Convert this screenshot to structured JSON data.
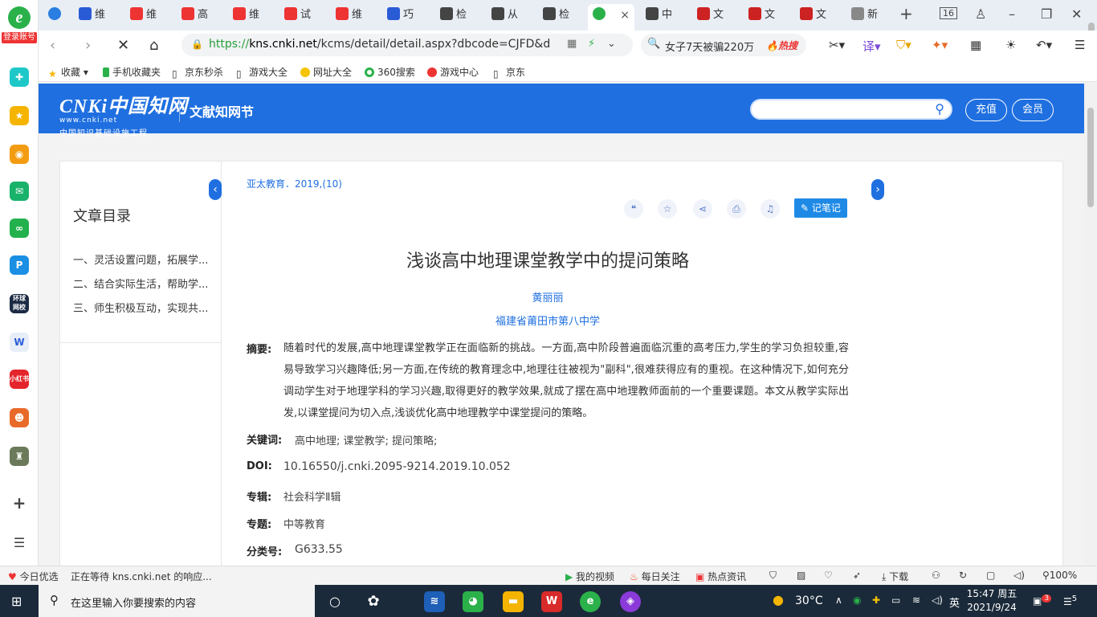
{
  "browser": {
    "login_label": "登录账号",
    "tabs": [
      {
        "label": "维",
        "color": "#2a5bd7"
      },
      {
        "label": "维",
        "color": "#e33"
      },
      {
        "label": "高",
        "color": "#e33"
      },
      {
        "label": "维",
        "color": "#e33"
      },
      {
        "label": "试",
        "color": "#e33"
      },
      {
        "label": "维",
        "color": "#e33"
      },
      {
        "label": "巧",
        "color": "#2a5bd7"
      },
      {
        "label": "检",
        "color": "#333"
      },
      {
        "label": "从",
        "color": "#333"
      },
      {
        "label": "检",
        "color": "#333"
      },
      {
        "label": "",
        "color": "#2bb14a"
      },
      {
        "label": "中",
        "color": "#333"
      },
      {
        "label": "文",
        "color": "#c22"
      },
      {
        "label": "文",
        "color": "#c22"
      },
      {
        "label": "文",
        "color": "#c22"
      },
      {
        "label": "新",
        "color": "#555"
      }
    ],
    "tab_count": "16",
    "close_glyph": "×",
    "url_proto": "https://",
    "url_host": "kns.cnki.net",
    "url_path": "/kcms/detail/detail.aspx?dbcode=CJFD&d",
    "search_query": "女子7天被骗220万",
    "search_hot": "🔥热搜",
    "bookmarks": [
      "收藏",
      "手机收藏夹",
      "京东秒杀",
      "游戏大全",
      "网址大全",
      "360搜索",
      "游戏中心",
      "京东"
    ]
  },
  "site": {
    "logo_text": "CNKi中国知网",
    "logo_url": "www.cnki.net",
    "logo_tagline": "中国知识基础设施工程",
    "section": "文献知网节",
    "recharge": "充值",
    "member": "会员"
  },
  "toc": {
    "title": "文章目录",
    "items": [
      "一、灵活设置问题，拓展学...",
      "二、结合实际生活，帮助学...",
      "三、师生积极互动，实现共..."
    ]
  },
  "article": {
    "source": "亚太教育．2019,(10)",
    "note_button": "记笔记",
    "title": "浅谈高中地理课堂教学中的提问策略",
    "author": "黄丽丽",
    "organization": "福建省莆田市第八中学",
    "abstract_label": "摘要:",
    "abstract": "随着时代的发展,高中地理课堂教学正在面临新的挑战。一方面,高中阶段普遍面临沉重的高考压力,学生的学习负担较重,容易导致学习兴趣降低;另一方面,在传统的教育理念中,地理往往被视为\"副科\",很难获得应有的重视。在这种情况下,如何充分调动学生对于地理学科的学习兴趣,取得更好的教学效果,就成了摆在高中地理教师面前的一个重要课题。本文从教学实际出发,以课堂提问为切入点,浅谈优化高中地理教学中课堂提问的策略。",
    "keywords_label": "关键词:",
    "keywords": "高中地理;  课堂教学;  提问策略;",
    "doi_label": "DOI:",
    "doi": "10.16550/j.cnki.2095-9214.2019.10.052",
    "series_label": "专辑:",
    "series": "社会科学Ⅱ辑",
    "topic_label": "专题:",
    "topic": "中等教育",
    "class_label": "分类号:",
    "class_no": "G633.55"
  },
  "status": {
    "today": "今日优选",
    "loading": "正在等待 kns.cnki.net 的响应...",
    "my_video": "我的视频",
    "daily": "每日关注",
    "hot_news": "热点资讯",
    "download": "下载",
    "zoom": "100%"
  },
  "taskbar": {
    "search_placeholder": "在这里输入你要搜索的内容",
    "weather": "30°C",
    "ime": "英",
    "time": "15:47 周五",
    "date": "2021/9/24",
    "notif_count": "5",
    "badge": "3"
  }
}
